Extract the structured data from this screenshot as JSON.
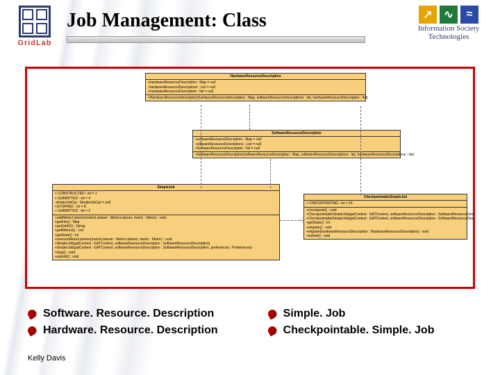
{
  "header": {
    "title": "Job Management: Class",
    "left_logo_text_a": "Grid",
    "left_logo_text_b": "Lab",
    "right_logo_line1": "Information Society",
    "right_logo_line2": "Technologies",
    "ist_glyph1": "↗",
    "ist_glyph2": "∿",
    "ist_glyph3": "≈"
  },
  "uml": {
    "hw": {
      "name": "HardwareResourceDescription",
      "attrs": "+hardwareResourceDescription : Map = null\n-hardwareResourceDescriptions : List = null\n+hardwareResourceDescription : list = null",
      "ops": "+HardwareResourceDescription(hardwareResourceDescription : Map, softwareResourceDescriptions : list, hardwareResourceDescription : list)"
    },
    "sw": {
      "name": "SoftwareResourceDescription",
      "attrs": "+softwareResourceDescription : Map = null\n-softwareResourceDescriptions : List = null\n+SoftwareResourceDescription : list = null",
      "ops": "+SoftwareResourceDescription(softwareResourceDescription : Map, softwareResourceDescriptions : list, hardwareResourceDescriptions : list)"
    },
    "sj": {
      "name": "SimpleJob",
      "attrs": "+ CONSTRUCTED : int = 1\n+ SUBMITTED : int = 4\n-simpleJobCpi : SimpleJobCpi = null\n+STOPPED : int = 8\n+ SUBMITTED : int = 2",
      "ops": "+addMetricListener(metricListener : MetricListener, metric : Metric) : void\n+getInfo() : Map\n+getJobID() : String\n+getMetrics() : List\n+getState() : int\n+removeMetricListener(metricListener : MetricListener, metric : Metric) : void\n+SimpleJob(gatContext : GATContext, softwareResourceDescription : SoftwareResourceDescription)\n+SimpleJob(gatContext : GATContext, softwareResourceDescription : SoftwareResourceDescription, preferences : Preferences)\n+stop() : void\n+submit() : void"
    },
    "cp": {
      "name": "CheckpointableSimpleJob",
      "attrs": "+ CHECKPOINTING : int = 16",
      "ops": "+checkpoint() : void\n+CheckpointableSimpleJob(gatContext : GATContext, softwareResourceDescription : SoftwareResourceDescription, preferences : Preferences)\n+CheckpointableSimpleJob(gatContext : GATContext, softwareResourceDescription : SoftwareResourceDescription)\n+getState() : int\n+migrate() : void\n+migrate(hardwareResourceDescription : HardwareResourceDescription) : void\n+submit() : void"
    }
  },
  "bullets": {
    "left": [
      "Software. Resource. Description",
      "Hardware. Resource. Description"
    ],
    "right": [
      "Simple. Job",
      "Checkpointable. Simple. Job"
    ]
  },
  "author": "Kelly Davis"
}
